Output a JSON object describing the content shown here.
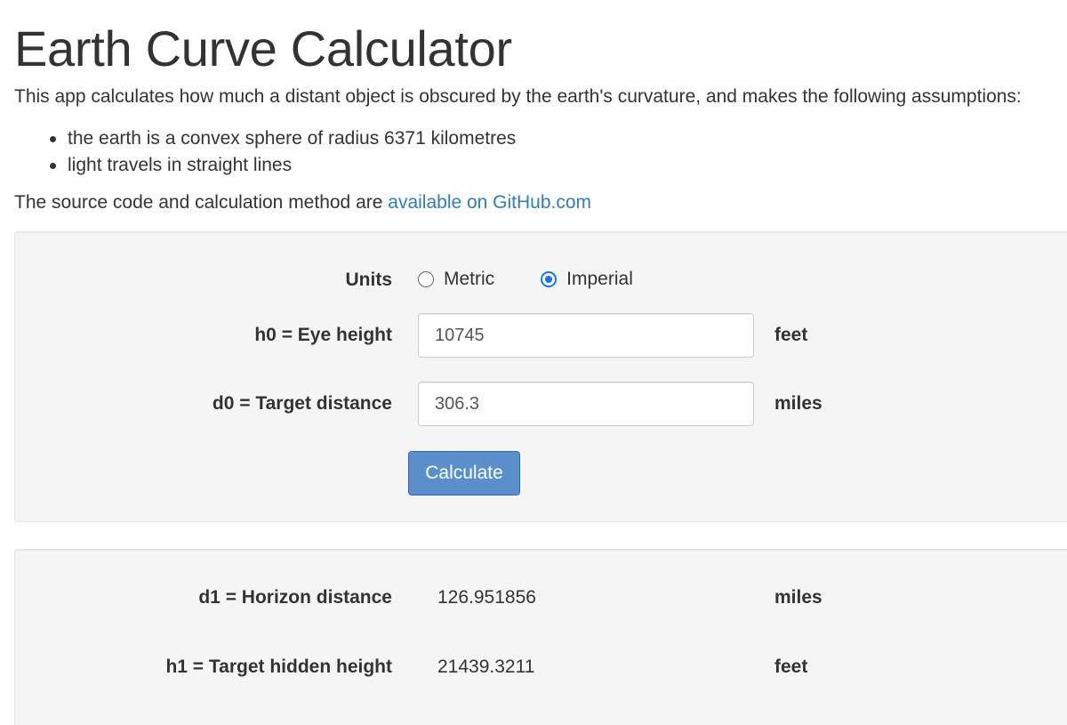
{
  "page": {
    "title": "Earth Curve Calculator",
    "intro": "This app calculates how much a distant object is obscured by the earth's curvature, and makes the following assumptions:",
    "assumptions": [
      "the earth is a convex sphere of radius 6371 kilometres",
      "light travels in straight lines"
    ],
    "source_prefix": "The source code and calculation method are ",
    "source_link": "available on GitHub.com"
  },
  "form": {
    "units_label": "Units",
    "unit_options": [
      {
        "label": "Metric",
        "checked": false
      },
      {
        "label": "Imperial",
        "checked": true
      }
    ],
    "eye_height_label": "h0 = Eye height",
    "eye_height_value": "10745",
    "eye_height_unit": "feet",
    "target_distance_label": "d0 = Target distance",
    "target_distance_value": "306.3",
    "target_distance_unit": "miles",
    "calculate_label": "Calculate"
  },
  "results": {
    "horizon_label": "d1 = Horizon distance",
    "horizon_value": "126.951856",
    "horizon_unit": "miles",
    "hidden_label": "h1 = Target hidden height",
    "hidden_value": "21439.3211",
    "hidden_unit": "feet"
  },
  "colors": {
    "link": "#337ab7",
    "button": "#5a8fcb",
    "radio_checked": "#1a73e8",
    "panel": "#f5f5f5"
  }
}
